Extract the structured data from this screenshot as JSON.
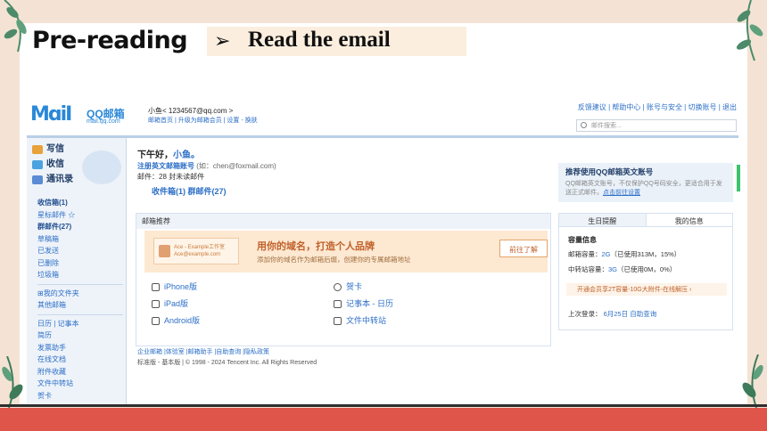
{
  "slide": {
    "title": "Pre-reading",
    "subtitle_arrow": "➢",
    "subtitle": "Read the email"
  },
  "mail": {
    "logo_m": "MɑiI",
    "logo_name": "QQ邮箱",
    "logo_url": "mail.qq.com",
    "account": "小鱼<  1234567@qq.com  >",
    "account_links": "邮箱首页 | 升级为邮箱会员 | 设置 - 换肤",
    "top_links": "反馈建议 | 帮助中心 | 账号与安全 | 切换账号 | 退出",
    "search_placeholder": "邮件搜索...",
    "sidebar": {
      "compose": "写信",
      "inbox": "收信",
      "contacts": "通讯录",
      "folders_a": [
        "收信箱(1)",
        "星标邮件 ☆",
        "群邮件(27)",
        "草稿箱",
        "已发送",
        "已删除",
        "垃圾箱"
      ],
      "folders_b": [
        "⊞我的文件夹",
        "其他邮箱"
      ],
      "folders_c": [
        "日历 | 记事本",
        "简历",
        "发票助手",
        "在线文档",
        "附件收藏",
        "文件中转站",
        "贺卡"
      ]
    },
    "main": {
      "greeting": "下午好，",
      "greeting_name": "小鱼。",
      "register": "注册英文邮箱账号",
      "register_hint": "(如：chen@foxmail.com)",
      "mail_count": "邮件：28 封未读邮件",
      "inbox_line": "收件箱(1)  群邮件(27)",
      "recommend_head": "邮箱推荐",
      "banner_card_1": "Ace - Example工作室",
      "banner_card_2": "Ace@example.com",
      "banner_title": "用你的域名，打造个人品牌",
      "banner_sub": "添加你的域名作为邮箱后缀，创建你的专属邮箱地址",
      "banner_button": "前往了解",
      "apps_left": [
        "iPhone版",
        "iPad版",
        "Android版"
      ],
      "apps_right": [
        "贺卡",
        "记事本 - 日历",
        "文件中转站"
      ],
      "footer_links": "企业邮箱 |体验室 |邮箱助手 |自助查询 |隐私政策",
      "footer_copy": "标准版 - 基本版 | © 1998 - 2024 Tencent Inc. All Rights Reserved"
    },
    "right": {
      "promo_title": "推荐使用QQ邮箱英文账号",
      "promo_text": "QQ邮箱英文账号，不仅保护QQ号码安全，更适合用于发送正式邮件。",
      "promo_link": "点击前往设置",
      "tab_birthday": "生日提醒",
      "tab_info": "我的信息",
      "capacity_head": "容量信息",
      "mail_cap_label": "邮箱容量：",
      "mail_cap_value": "2G",
      "mail_cap_used": "（已使用313M，15%）",
      "transfer_label": "中转站容量：",
      "transfer_value": "3G",
      "transfer_used": "（已使用0M，0%）",
      "vip": "开通会员享2T容量-10G大附件-在线解压 ›",
      "last_login_label": "上次登录：",
      "last_login_date": "6月25日",
      "last_login_link": "自助查询"
    }
  }
}
